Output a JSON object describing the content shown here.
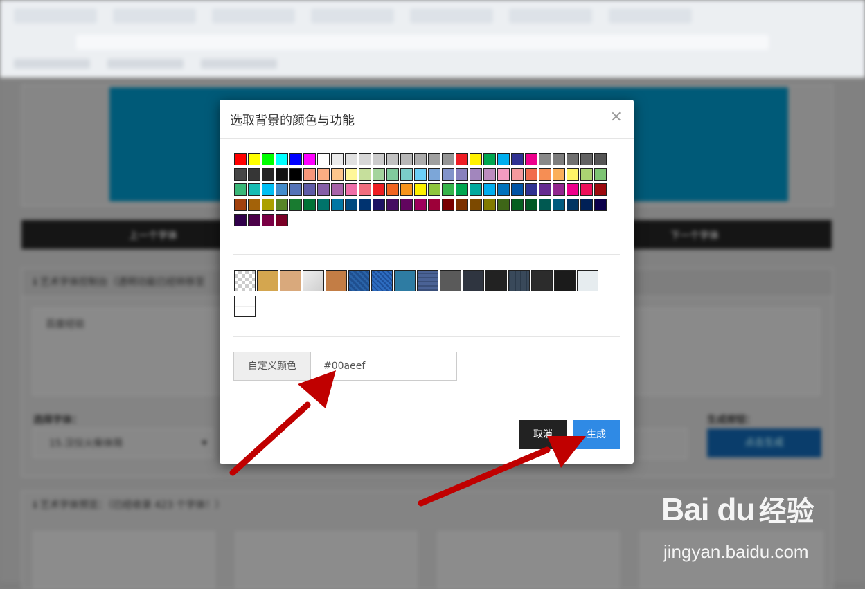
{
  "background_page": {
    "nav": {
      "prev_label": "上一个字体",
      "next_label": "下一个字体"
    },
    "console": {
      "title": "艺术字体控制台（透明功能已经转移至",
      "text_value": "百度经验",
      "font_label": "选择字体：",
      "font_selected": "15.汉仪火柴体简",
      "generate_label": "生成按钮：",
      "generate_button": "点击生成"
    },
    "preview": {
      "title": "艺术字体预览：（已经收录 423 个字体！）"
    }
  },
  "modal": {
    "title": "选取背景的颜色与功能",
    "close": "×",
    "colors": [
      "#ff0000",
      "#ffff00",
      "#00ff00",
      "#00ffff",
      "#0000ff",
      "#ff00ff",
      "#ffffff",
      "#ebebeb",
      "#e1e1e1",
      "#d7d7d7",
      "#cccccc",
      "#c2c2c2",
      "#b7b7b7",
      "#acacac",
      "#a0a0a0",
      "#959595",
      "#ee1d24",
      "#fff100",
      "#00a650",
      "#00aeef",
      "#2f3192",
      "#ed008c",
      "#898989",
      "#7d7d7d",
      "#707070",
      "#626262",
      "#555555",
      "#464646",
      "#363636",
      "#262626",
      "#111111",
      "#000000",
      "#f7977a",
      "#fbad82",
      "#fdc68c",
      "#fff799",
      "#c6df9c",
      "#a4d49d",
      "#81ca9d",
      "#7bcdc9",
      "#6ccff7",
      "#7ca6d8",
      "#8293ca",
      "#8881be",
      "#a286bd",
      "#bc8cbf",
      "#f49bc1",
      "#f5999d",
      "#f16c4d",
      "#f68e54",
      "#fbaf5a",
      "#fff467",
      "#acd372",
      "#7dc473",
      "#39b778",
      "#16bcb4",
      "#00bff3",
      "#438ccb",
      "#5573b7",
      "#5e5ca7",
      "#855fa8",
      "#a763a9",
      "#ef6ea8",
      "#f16d7e",
      "#ee1d24",
      "#f16522",
      "#f7941d",
      "#fff100",
      "#8fc63d",
      "#37b44a",
      "#00a650",
      "#00a99e",
      "#00aeef",
      "#0072bc",
      "#0054a5",
      "#2f3192",
      "#652c91",
      "#91278f",
      "#ed008c",
      "#ee105a",
      "#9d0a0f",
      "#a1410d",
      "#a36209",
      "#aba000",
      "#588528",
      "#197b30",
      "#007236",
      "#00736a",
      "#0076a4",
      "#004a80",
      "#003370",
      "#1d1363",
      "#450e61",
      "#62055f",
      "#9e005c",
      "#9d0039",
      "#790000",
      "#7b3000",
      "#7c4900",
      "#827a00",
      "#3e6617",
      "#045f20",
      "#005824",
      "#005951",
      "#005b7e",
      "#003562",
      "#002056",
      "#0c004b",
      "#30004a",
      "#4b0048",
      "#7a0045",
      "#7a0026"
    ],
    "textures": [
      "checker",
      "gold",
      "tan",
      "paper",
      "leather",
      "navy-lines",
      "blue-pattern",
      "teal-swirl",
      "blue-grid",
      "gray-dark",
      "charcoal",
      "black-circle",
      "dark-grid",
      "graphite",
      "black",
      "light-floral",
      "white-panel"
    ],
    "custom_color_label": "自定义颜色",
    "custom_color_value": "#00aeef",
    "cancel_label": "取消",
    "generate_label": "生成"
  },
  "watermark": {
    "logo": "Bai du",
    "cn": "经验",
    "url": "jingyan.baidu.com"
  }
}
